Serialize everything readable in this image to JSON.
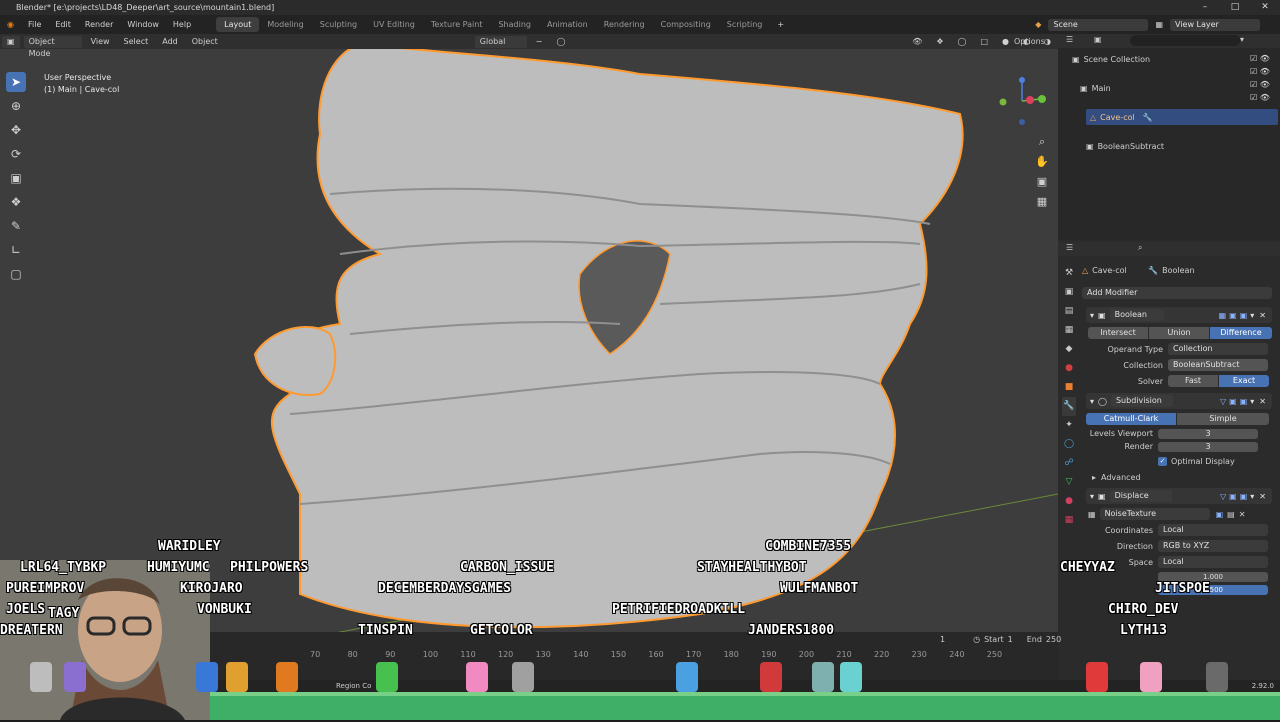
{
  "window": {
    "title": "Blender* [e:\\projects\\LD48_Deeper\\art_source\\mountain1.blend]"
  },
  "menu": {
    "items": [
      "File",
      "Edit",
      "Render",
      "Window",
      "Help"
    ]
  },
  "workspaces": {
    "tabs": [
      "Layout",
      "Modeling",
      "Sculpting",
      "UV Editing",
      "Texture Paint",
      "Shading",
      "Animation",
      "Rendering",
      "Compositing",
      "Scripting"
    ],
    "active": "Layout"
  },
  "topbar": {
    "scene": "Scene",
    "view_layer": "View Layer"
  },
  "viewport": {
    "mode": "Object Mode",
    "menus": [
      "View",
      "Select",
      "Add",
      "Object"
    ],
    "transform": "Global",
    "options": "Options",
    "info_line1": "User Perspective",
    "info_line2": "(1) Main | Cave-col"
  },
  "outliner": {
    "root": "Scene Collection",
    "items": [
      {
        "label": "Main"
      },
      {
        "label": "Cave-col"
      },
      {
        "label": "BooleanSubtract"
      }
    ]
  },
  "properties": {
    "object": "Cave-col",
    "modifier_tab": "Boolean",
    "add_modifier": "Add Modifier",
    "boolean": {
      "name": "Boolean",
      "ops": [
        "Intersect",
        "Union",
        "Difference"
      ],
      "op_active": "Difference",
      "operand_label": "Operand Type",
      "operand_value": "Collection",
      "collection_label": "Collection",
      "collection_value": "BooleanSubtract",
      "solver_label": "Solver",
      "solver_opts": [
        "Fast",
        "Exact"
      ],
      "solver_active": "Exact"
    },
    "subdivision": {
      "name": "Subdivision",
      "types": [
        "Catmull-Clark",
        "Simple"
      ],
      "levels_label": "Levels Viewport",
      "levels_value": "3",
      "render_label": "Render",
      "render_value": "3",
      "optimal": "Optimal Display",
      "advanced": "Advanced"
    },
    "displace": {
      "name": "Displace",
      "texture": "NoiseTexture",
      "coords_label": "Coordinates",
      "coords_value": "Local",
      "direction_label": "Direction",
      "direction_value": "RGB to XYZ",
      "space_label": "Space",
      "space_value": "Local",
      "strength_value": "1.000",
      "midlevel_value": "0.500"
    }
  },
  "timeline": {
    "ticks": [
      "70",
      "80",
      "90",
      "100",
      "110",
      "120",
      "130",
      "140",
      "150",
      "160",
      "170",
      "180",
      "190",
      "200",
      "210",
      "220",
      "230",
      "240",
      "250"
    ],
    "current": "1",
    "start_label": "Start",
    "start_value": "1",
    "end_label": "End",
    "end_value": "250"
  },
  "status": {
    "left": "Region Co",
    "version": "2.92.0"
  },
  "overlay": {
    "names": [
      "WARIDLEY",
      "LRL64_TYBKP",
      "HUMIYUMC",
      "PHILPOWERS",
      "PUREIMPROV",
      "KIROJARO",
      "JOELS",
      "TAGY",
      "VONBUKI",
      "DREATERN",
      "CARBON_ISSUE",
      "DECEMBERDAYSGAMES",
      "TINSPIN",
      "GETCOLOR",
      "PETRIFIEDROADKILL",
      "COMBINE7355",
      "STAYHEALTHYBOT",
      "WULFMANBOT",
      "JANDERS1800",
      "CHEYYAZ",
      "JITSPOE",
      "CHIRO_DEV",
      "LYTH13"
    ]
  }
}
